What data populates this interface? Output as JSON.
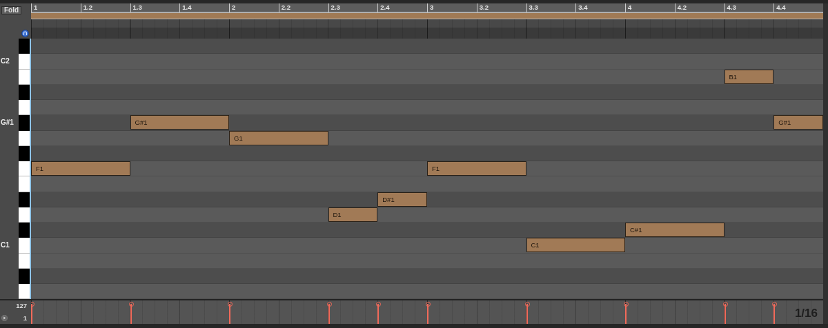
{
  "fold_button": "Fold",
  "ruler": [
    "1",
    "1.2",
    "1.3",
    "1.4",
    "2",
    "2.2",
    "2.3",
    "2.4",
    "3",
    "3.2",
    "3.3",
    "3.4",
    "4",
    "4.2",
    "4.3",
    "4.4"
  ],
  "keys": [
    {
      "kind": "black"
    },
    {
      "kind": "white",
      "label": "C2"
    },
    {
      "kind": "white"
    },
    {
      "kind": "black"
    },
    {
      "kind": "white"
    },
    {
      "kind": "black",
      "label": "G#1"
    },
    {
      "kind": "white"
    },
    {
      "kind": "black"
    },
    {
      "kind": "white"
    },
    {
      "kind": "white"
    },
    {
      "kind": "black"
    },
    {
      "kind": "white"
    },
    {
      "kind": "black"
    },
    {
      "kind": "white",
      "label": "C1"
    },
    {
      "kind": "white"
    },
    {
      "kind": "black"
    },
    {
      "kind": "white"
    }
  ],
  "notes": [
    {
      "label": "F1",
      "kind": "half",
      "level": 1
    },
    {
      "label": "G#1",
      "kind": "half",
      "level": 1
    },
    {
      "label": "G1",
      "kind": "half",
      "level": 1
    },
    {
      "label": "D1",
      "kind": "quarter",
      "level": 1
    },
    {
      "label": "D#1",
      "kind": "quarter",
      "level": 1
    },
    {
      "label": "F1",
      "kind": "half",
      "level": 1
    },
    {
      "label": "C1",
      "kind": "half",
      "level": 1
    },
    {
      "label": "C#1",
      "kind": "half",
      "level": 1
    },
    {
      "label": "B1",
      "kind": "quarter",
      "level": 1
    },
    {
      "label": "G#1",
      "kind": "quarter",
      "level": 1
    }
  ],
  "velocity": {
    "max": "127",
    "min": "1"
  },
  "grid_size": "1/16"
}
